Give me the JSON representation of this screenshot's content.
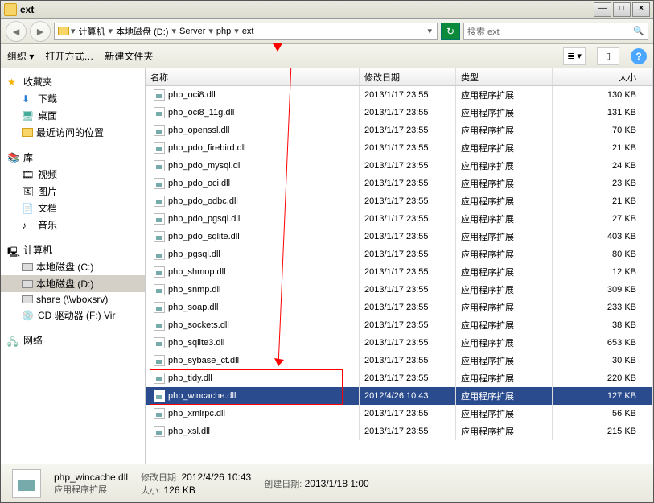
{
  "title": "ext",
  "breadcrumb": [
    "计算机",
    "本地磁盘 (D:)",
    "Server",
    "php",
    "ext"
  ],
  "search_placeholder": "搜索 ext",
  "toolbar": {
    "organize": "组织 ▾",
    "open_with": "打开方式…",
    "new_folder": "新建文件夹"
  },
  "columns": {
    "name": "名称",
    "date": "修改日期",
    "type": "类型",
    "size": "大小"
  },
  "type_label": "应用程序扩展",
  "files": [
    {
      "name": "php_oci8.dll",
      "date": "2013/1/17 23:55",
      "size": "130 KB"
    },
    {
      "name": "php_oci8_11g.dll",
      "date": "2013/1/17 23:55",
      "size": "131 KB"
    },
    {
      "name": "php_openssl.dll",
      "date": "2013/1/17 23:55",
      "size": "70 KB"
    },
    {
      "name": "php_pdo_firebird.dll",
      "date": "2013/1/17 23:55",
      "size": "21 KB"
    },
    {
      "name": "php_pdo_mysql.dll",
      "date": "2013/1/17 23:55",
      "size": "24 KB"
    },
    {
      "name": "php_pdo_oci.dll",
      "date": "2013/1/17 23:55",
      "size": "23 KB"
    },
    {
      "name": "php_pdo_odbc.dll",
      "date": "2013/1/17 23:55",
      "size": "21 KB"
    },
    {
      "name": "php_pdo_pgsql.dll",
      "date": "2013/1/17 23:55",
      "size": "27 KB"
    },
    {
      "name": "php_pdo_sqlite.dll",
      "date": "2013/1/17 23:55",
      "size": "403 KB"
    },
    {
      "name": "php_pgsql.dll",
      "date": "2013/1/17 23:55",
      "size": "80 KB"
    },
    {
      "name": "php_shmop.dll",
      "date": "2013/1/17 23:55",
      "size": "12 KB"
    },
    {
      "name": "php_snmp.dll",
      "date": "2013/1/17 23:55",
      "size": "309 KB"
    },
    {
      "name": "php_soap.dll",
      "date": "2013/1/17 23:55",
      "size": "233 KB"
    },
    {
      "name": "php_sockets.dll",
      "date": "2013/1/17 23:55",
      "size": "38 KB"
    },
    {
      "name": "php_sqlite3.dll",
      "date": "2013/1/17 23:55",
      "size": "653 KB"
    },
    {
      "name": "php_sybase_ct.dll",
      "date": "2013/1/17 23:55",
      "size": "30 KB"
    },
    {
      "name": "php_tidy.dll",
      "date": "2013/1/17 23:55",
      "size": "220 KB"
    },
    {
      "name": "php_wincache.dll",
      "date": "2012/4/26 10:43",
      "size": "127 KB",
      "selected": true
    },
    {
      "name": "php_xmlrpc.dll",
      "date": "2013/1/17 23:55",
      "size": "56 KB"
    },
    {
      "name": "php_xsl.dll",
      "date": "2013/1/17 23:55",
      "size": "215 KB"
    }
  ],
  "sidebar": {
    "favorites": "收藏夹",
    "fav_items": [
      "下载",
      "桌面",
      "最近访问的位置"
    ],
    "library": "库",
    "lib_items": [
      "视频",
      "图片",
      "文档",
      "音乐"
    ],
    "computer": "计算机",
    "comp_items": [
      "本地磁盘 (C:)",
      "本地磁盘 (D:)",
      "share (\\\\vboxsrv)",
      "CD 驱动器 (F:) Vir"
    ],
    "network": "网络"
  },
  "preview": {
    "filename": "php_wincache.dll",
    "type_line": "应用程序扩展",
    "mod_label": "修改日期:",
    "mod_value": "2012/4/26 10:43",
    "size_label": "大小:",
    "size_value": "126 KB",
    "created_label": "创建日期:",
    "created_value": "2013/1/18 1:00"
  }
}
